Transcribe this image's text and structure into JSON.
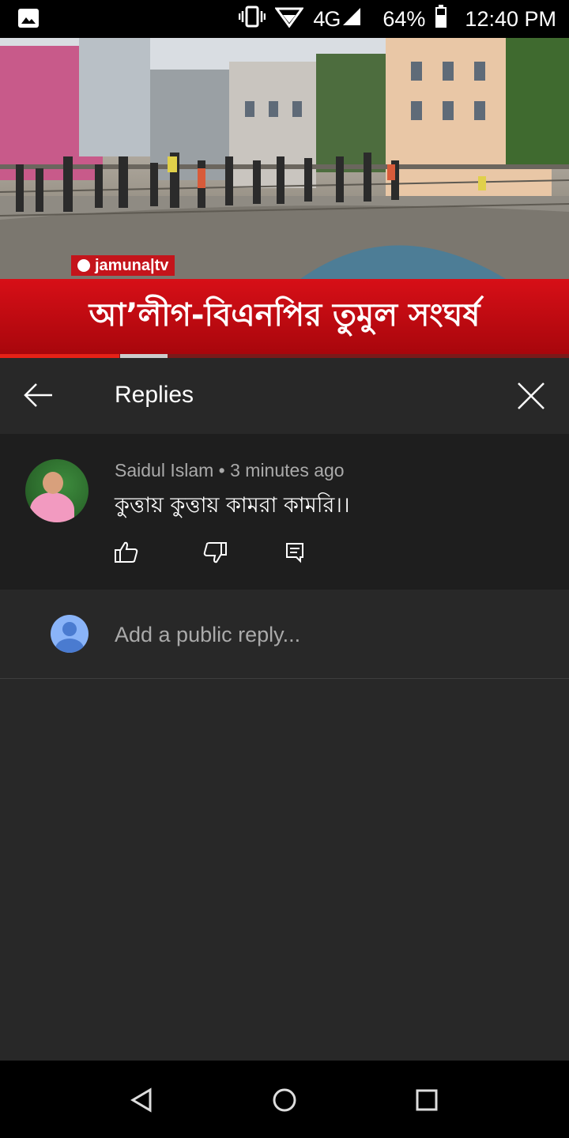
{
  "status_bar": {
    "network": "4G",
    "battery": "64%",
    "time": "12:40 PM",
    "icons": [
      "gallery-icon",
      "vibrate-icon",
      "wifi-icon",
      "signal-icon",
      "battery-icon"
    ]
  },
  "video": {
    "channel_logo": "jamuna|tv",
    "headline": "আ’লীগ-বিএনপির তুমুল সংঘর্ষ",
    "progress": 0.21
  },
  "replies_panel": {
    "title": "Replies",
    "icons": [
      "back-arrow-icon",
      "close-icon"
    ]
  },
  "comment": {
    "author": "Saidul Islam",
    "time": "3 minutes ago",
    "meta": "Saidul Islam • 3 minutes ago",
    "text": "কুত্তায় কুত্তায় কামরা কামরি।।",
    "actions": [
      "like-icon",
      "dislike-icon",
      "reply-icon"
    ]
  },
  "reply_box": {
    "placeholder": "Add a public reply..."
  },
  "colors": {
    "panel_bg": "#282828",
    "comment_bg": "#1e1e1e",
    "banner_red": "#d70f17",
    "muted_text": "#aaaaaa"
  }
}
